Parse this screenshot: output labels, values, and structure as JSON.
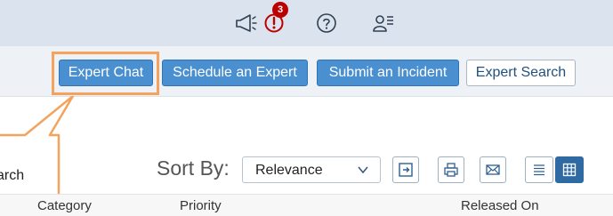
{
  "shellbar": {
    "notification_count": "3",
    "icons": [
      "megaphone-icon",
      "notification-icon",
      "help-icon",
      "user-menu-icon"
    ]
  },
  "toolbar": {
    "expert_chat": "Expert Chat",
    "schedule_expert": "Schedule an Expert",
    "submit_incident": "Submit an Incident",
    "expert_search": "Expert Search"
  },
  "callout": {
    "label": "arch"
  },
  "sort": {
    "label": "Sort By:",
    "selected": "Relevance",
    "view_mode": "grid"
  },
  "table": {
    "columns": [
      "Category",
      "Priority",
      "Released On"
    ]
  },
  "colors": {
    "primary": "#4a8fd0",
    "highlight": "#f5a25c",
    "badge": "#bb0000",
    "shell": "#dbe4ee"
  }
}
